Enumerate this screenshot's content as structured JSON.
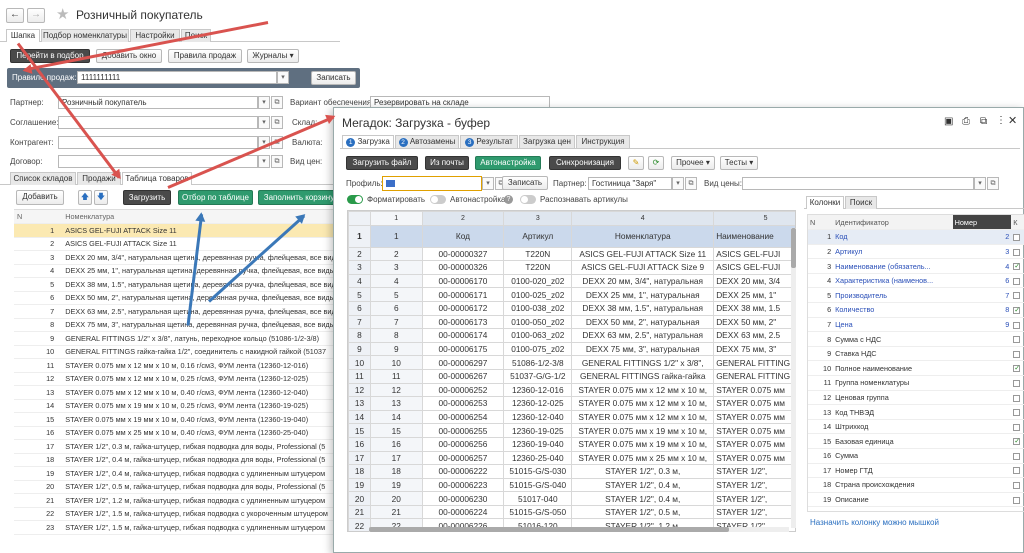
{
  "window": {
    "title": "Розничный покупатель"
  },
  "main_tabs": [
    "Шапка",
    "Подбор номенклатуры",
    "Настройки",
    "Поиск"
  ],
  "toolbar": {
    "go_select": "Перейти в подбор",
    "add_window": "Добавить окно",
    "sale_rules": "Правила продаж",
    "journals": "Журналы"
  },
  "rule": {
    "label": "Правило продаж:",
    "value": "1111111111",
    "write": "Записать"
  },
  "form": {
    "partner_label": "Партнер:",
    "partner_value": "Розничный покупатель",
    "agreement_label": "Соглашение:",
    "contractor_label": "Контрагент:",
    "contract_label": "Договор:",
    "provision_label": "Вариант обеспечения:",
    "provision_value": "Резервировать на складе",
    "warehouse_label": "Склад:",
    "currency_label": "Валюта:",
    "price_type_label": "Вид цен:"
  },
  "sub_tabs": [
    "Список складов",
    "Продажи",
    "Таблица товаров"
  ],
  "list_toolbar": {
    "add": "Добавить",
    "load": "Загрузить",
    "filter": "Отбор по таблице",
    "fill_cart": "Заполнить корзину"
  },
  "list": {
    "col_n": "N",
    "col_name": "Номенклатура",
    "rows": [
      "ASICS GEL-FUJI ATTACK Size 11",
      "ASICS GEL-FUJI ATTACK Size 11",
      "DEXX 20 мм, 3/4\", натуральная щетина, деревянная ручка, флейцевая, все виды",
      "DEXX 25 мм, 1\", натуральная щетина, деревянная ручка, флейцевая, все виды",
      "DEXX 38 мм, 1.5\", натуральная щетина, деревянная ручка, флейцевая, все виды",
      "DEXX 50 мм, 2\", натуральная щетина, деревянная ручка, флейцевая, все виды",
      "DEXX 63 мм, 2.5\", натуральная щетина, деревянная ручка, флейцевая, все виды",
      "DEXX 75 мм, 3\", натуральная щетина, деревянная ручка, флейцевая, все виды",
      "GENERAL FITTINGS 1/2\" x 3/8\", латунь, переходное кольцо (51086-1/2-3/8)",
      "GENERAL FITTINGS гайка-гайка 1/2\", соединитель с накидной гайкой (51037",
      "STAYER 0.075 мм x 12 мм x 10 м, 0.16 г/см3, ФУМ лента (12360-12-016)",
      "STAYER 0.075 мм x 12 мм x 10 м, 0.25 г/см3, ФУМ лента (12360-12-025)",
      "STAYER 0.075 мм x 12 мм x 10 м, 0.40 г/см3, ФУМ лента (12360-12-040)",
      "STAYER 0.075 мм x 19 мм x 10 м, 0.25 г/см3, ФУМ лента (12360-19-025)",
      "STAYER 0.075 мм x 19 мм x 10 м, 0.40 г/см3, ФУМ лента (12360-19-040)",
      "STAYER 0.075 мм x 25 мм x 10 м, 0.40 г/см3, ФУМ лента (12360-25-040)",
      "STAYER 1/2\", 0.3 м, гайка-штуцер, гибкая подводка для воды, Professional (5",
      "STAYER 1/2\", 0.4 м, гайка-штуцер, гибкая подводка для воды, Professional (5",
      "STAYER 1/2\", 0.4 м, гайка-штуцер, гибкая подводка с удлиненным штуцером",
      "STAYER 1/2\", 0.5 м, гайка-штуцер, гибкая подводка для воды, Professional (5",
      "STAYER 1/2\", 1.2 м, гайка-штуцер, гибкая подводка с удлиненным штуцером",
      "STAYER 1/2\", 1.5 м, гайка-штуцер, гибкая подводка с укороченным штуцером",
      "STAYER 1/2\", 1.5 м, гайка-штуцер, гибкая подводка с удлиненным штуцером"
    ]
  },
  "dialog": {
    "title": "Мегадок: Загрузка - буфер",
    "steps": [
      {
        "num": "1",
        "label": "Загрузка"
      },
      {
        "num": "2",
        "label": "Автозамены"
      },
      {
        "num": "3",
        "label": "Результат"
      },
      {
        "num": "",
        "label": "Загрузка цен"
      },
      {
        "num": "",
        "label": "Инструкция"
      }
    ],
    "toolbar": {
      "load_file": "Загрузить файл",
      "from_mail": "Из почты",
      "autosetup": "Автонастройка",
      "sync": "Синхронизация",
      "other": "Прочее",
      "tests": "Тесты"
    },
    "profile_label": "Профиль:",
    "write": "Записать",
    "partner_label": "Партнер:",
    "partner_value": "Гостиница \"Заря\"",
    "price_type_label": "Вид цены:",
    "toggles": {
      "format": "Форматировать",
      "autosetup": "Автонастройка",
      "recognize": "Распознавать артикулы"
    },
    "grid": {
      "col_nums": [
        "1",
        "2",
        "3",
        "4",
        "5"
      ],
      "headers": [
        "1",
        "Код",
        "Артикул",
        "Номенклатура",
        "Наименование"
      ],
      "rows": [
        [
          "2",
          "00-00000327",
          "T220N",
          "ASICS GEL-FUJI ATTACK Size 11",
          "ASICS GEL-FUJI"
        ],
        [
          "3",
          "00-00000326",
          "T220N",
          "ASICS GEL-FUJI ATTACK Size 9",
          "ASICS GEL-FUJI"
        ],
        [
          "4",
          "00-00006170",
          "0100-020_z02",
          "DEXX 20 мм, 3/4\", натуральная",
          "DEXX 20 мм, 3/4"
        ],
        [
          "5",
          "00-00006171",
          "0100-025_z02",
          "DEXX 25 мм, 1\", натуральная",
          "DEXX 25 мм, 1\""
        ],
        [
          "6",
          "00-00006172",
          "0100-038_z02",
          "DEXX 38 мм, 1.5\", натуральная",
          "DEXX 38 мм, 1.5"
        ],
        [
          "7",
          "00-00006173",
          "0100-050_z02",
          "DEXX 50 мм, 2\", натуральная",
          "DEXX 50 мм, 2\""
        ],
        [
          "8",
          "00-00006174",
          "0100-063_z02",
          "DEXX 63 мм, 2.5\", натуральная",
          "DEXX 63 мм, 2.5"
        ],
        [
          "9",
          "00-00006175",
          "0100-075_z02",
          "DEXX 75 мм, 3\", натуральная",
          "DEXX 75 мм, 3\""
        ],
        [
          "10",
          "00-00006297",
          "51086-1/2-3/8",
          "GENERAL FITTINGS 1/2\" x 3/8\",",
          "GENERAL FITTING"
        ],
        [
          "11",
          "00-00006267",
          "51037-G/G-1/2",
          "GENERAL FITTINGS гайка-гайка",
          "GENERAL FITTING"
        ],
        [
          "12",
          "00-00006252",
          "12360-12-016",
          "STAYER 0.075 мм x 12 мм x 10 м,",
          "STAYER 0.075 мм"
        ],
        [
          "13",
          "00-00006253",
          "12360-12-025",
          "STAYER 0.075 мм x 12 мм x 10 м,",
          "STAYER 0.075 мм"
        ],
        [
          "14",
          "00-00006254",
          "12360-12-040",
          "STAYER 0.075 мм x 12 мм x 10 м,",
          "STAYER 0.075 мм"
        ],
        [
          "15",
          "00-00006255",
          "12360-19-025",
          "STAYER 0.075 мм x 19 мм x 10 м,",
          "STAYER 0.075 мм"
        ],
        [
          "16",
          "00-00006256",
          "12360-19-040",
          "STAYER 0.075 мм x 19 мм x 10 м,",
          "STAYER 0.075 мм"
        ],
        [
          "17",
          "00-00006257",
          "12360-25-040",
          "STAYER 0.075 мм x 25 мм x 10 м,",
          "STAYER 0.075 мм"
        ],
        [
          "18",
          "00-00006222",
          "51015-G/S-030",
          "STAYER 1/2\", 0.3 м,",
          "STAYER 1/2\","
        ],
        [
          "19",
          "00-00006223",
          "51015-G/S-040",
          "STAYER 1/2\", 0.4 м,",
          "STAYER 1/2\","
        ],
        [
          "20",
          "00-00006230",
          "51017-040",
          "STAYER 1/2\", 0.4 м,",
          "STAYER 1/2\","
        ],
        [
          "21",
          "00-00006224",
          "51015-G/S-050",
          "STAYER 1/2\", 0.5 м,",
          "STAYER 1/2\","
        ],
        [
          "22",
          "00-00006226",
          "51016-120",
          "STAYER 1/2\", 1.2 м,",
          "STAYER 1/2\","
        ],
        [
          "23",
          "00-00006227",
          "51017-150",
          "STAYER 1/2\", 1.5 м,",
          "STAYER 1/2\","
        ]
      ]
    },
    "side_tabs": [
      "Колонки",
      "Поиск"
    ],
    "cols": {
      "headers": [
        "N",
        "Идентификатор",
        "Номер",
        "К"
      ],
      "rows": [
        {
          "n": "1",
          "name": "Код",
          "num": "2",
          "chk": false,
          "blue": true
        },
        {
          "n": "2",
          "name": "Артикул",
          "num": "3",
          "chk": false,
          "blue": true
        },
        {
          "n": "3",
          "name": "Наименование (обязатель...",
          "num": "4",
          "chk": true,
          "blue": true
        },
        {
          "n": "4",
          "name": "Характеристика (наименов...",
          "num": "6",
          "chk": false,
          "blue": true
        },
        {
          "n": "5",
          "name": "Производитель",
          "num": "7",
          "chk": false,
          "blue": true
        },
        {
          "n": "6",
          "name": "Количество",
          "num": "8",
          "chk": true,
          "blue": true
        },
        {
          "n": "7",
          "name": "Цена",
          "num": "9",
          "chk": false,
          "blue": true
        },
        {
          "n": "8",
          "name": "Сумма с НДС",
          "num": "",
          "chk": false,
          "blue": false
        },
        {
          "n": "9",
          "name": "Ставка НДС",
          "num": "",
          "chk": false,
          "blue": false
        },
        {
          "n": "10",
          "name": "Полное наименование",
          "num": "",
          "chk": true,
          "blue": false
        },
        {
          "n": "11",
          "name": "Группа номенклатуры",
          "num": "",
          "chk": false,
          "blue": false
        },
        {
          "n": "12",
          "name": "Ценовая группа",
          "num": "",
          "chk": false,
          "blue": false
        },
        {
          "n": "13",
          "name": "Код ТНВЭД",
          "num": "",
          "chk": false,
          "blue": false
        },
        {
          "n": "14",
          "name": "Штрихкод",
          "num": "",
          "chk": false,
          "blue": false
        },
        {
          "n": "15",
          "name": "Базовая единица",
          "num": "",
          "chk": true,
          "blue": false
        },
        {
          "n": "16",
          "name": "Сумма",
          "num": "",
          "chk": false,
          "blue": false
        },
        {
          "n": "17",
          "name": "Номер ГТД",
          "num": "",
          "chk": false,
          "blue": false
        },
        {
          "n": "18",
          "name": "Страна происхождения",
          "num": "",
          "chk": false,
          "blue": false
        },
        {
          "n": "19",
          "name": "Описание",
          "num": "",
          "chk": false,
          "blue": false
        }
      ],
      "hint": "Назначить колонку можно мышкой"
    }
  }
}
